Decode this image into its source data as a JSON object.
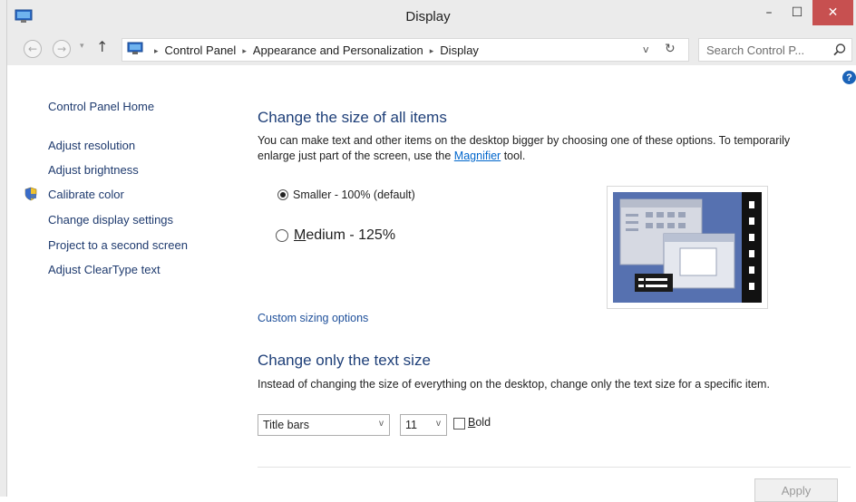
{
  "window": {
    "title": "Display",
    "icon": "display-control-panel-icon",
    "controls": {
      "minimize": "–",
      "maximize": "☐",
      "close": "✕"
    }
  },
  "addressbar": {
    "back_icon": "←",
    "forward_icon": "→",
    "recent_icon": "▾",
    "up_icon": "↑",
    "breadcrumbs": [
      "Control Panel",
      "Appearance and Personalization",
      "Display"
    ],
    "separator": "▸",
    "dropdown_icon": "v",
    "refresh_icon": "↻",
    "search_placeholder": "Search Control P..."
  },
  "help_label": "?",
  "sidebar": {
    "home": "Control Panel Home",
    "links": [
      "Adjust resolution",
      "Adjust brightness",
      "Calibrate color",
      "Change display settings",
      "Project to a second screen",
      "Adjust ClearType text"
    ]
  },
  "main": {
    "section1": {
      "heading": "Change the size of all items",
      "desc_before": "You can make text and other items on the desktop bigger by choosing one of these options. To temporarily enlarge just part of the screen, use the ",
      "desc_link": "Magnifier",
      "desc_after": " tool.",
      "options": [
        {
          "label": "Smaller - 100% (default)",
          "selected": true
        },
        {
          "label_access": "M",
          "label_rest": "edium - 125%",
          "selected": false
        }
      ],
      "custom_link": "Custom sizing options"
    },
    "section2": {
      "heading": "Change only the text size",
      "desc": "Instead of changing the size of everything on the desktop, change only the text size for a specific item.",
      "item_select": "Title bars",
      "size_select": "11",
      "select_arrow": "v",
      "bold_access": "B",
      "bold_rest": "old",
      "bold_checked": false
    },
    "apply_label": "Apply"
  },
  "colors": {
    "accent_heading": "#1e3f78",
    "link": "#0066cc",
    "close_button": "#c75050",
    "chrome": "#ebebeb",
    "preview_desktop": "#5671b0"
  }
}
